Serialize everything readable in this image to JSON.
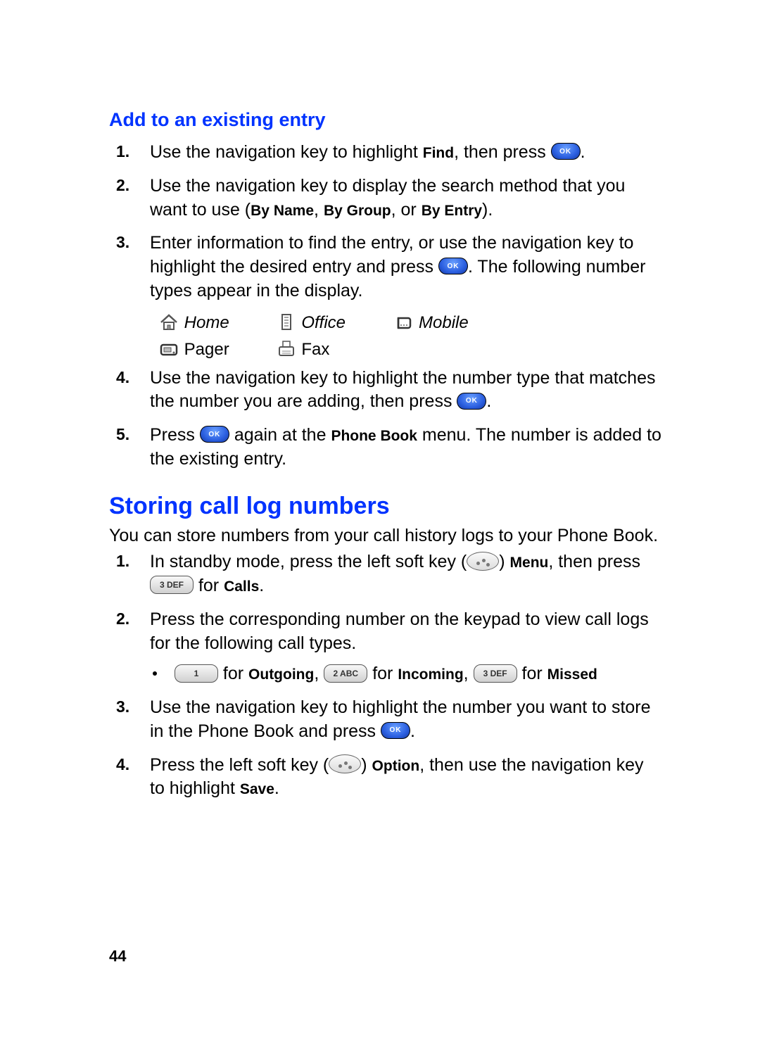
{
  "page_number": "44",
  "sectionA": {
    "title": "Add to an existing entry",
    "steps": [
      {
        "num": "1.",
        "t1": "Use the navigation key to highlight ",
        "b1": "Find",
        "t2": ", then press "
      },
      {
        "num": "2.",
        "t1": "Use the navigation key to display the search method that you want to use (",
        "b1": "By Name",
        "t2": ", ",
        "b2": "By Group",
        "t3": ", or ",
        "b3": "By Entry",
        "t4": ")."
      },
      {
        "num": "3.",
        "t1": "Enter information to find the entry, or use the navigation key to highlight the desired entry and press ",
        "t2": ". The following number types appear in the display."
      },
      {
        "num": "4.",
        "t1": "Use the navigation key to highlight the number type that matches the number you are adding, then press "
      },
      {
        "num": "5.",
        "t1": "Press ",
        "t2": " again at the ",
        "b1": "Phone Book",
        "t3": " menu. The number is added to the existing entry."
      }
    ],
    "types": {
      "home": "Home",
      "office": "Office",
      "mobile": "Mobile",
      "pager": "Pager",
      "fax": "Fax"
    }
  },
  "sectionB": {
    "title": "Storing call log numbers",
    "intro": "You can store numbers from your call history logs to your Phone Book.",
    "steps": [
      {
        "num": "1.",
        "t1": "In standby mode, press the left soft key (",
        "t2": ") ",
        "b1": "Menu",
        "t3": ", then press ",
        "t4": " for ",
        "b2": "Calls",
        "t5": "."
      },
      {
        "num": "2.",
        "t1": "Press the corresponding number on the keypad to view call logs for the following call types.",
        "bullet_for": " for ",
        "bullet_outgoing": "Outgoing",
        "bullet_sep1": ", ",
        "bullet_for2": " for ",
        "bullet_incoming": "Incoming",
        "bullet_sep2": ", ",
        "bullet_for3": " for ",
        "bullet_missed": "Missed"
      },
      {
        "num": "3.",
        "t1": "Use the navigation key to highlight the number you want to store in the Phone Book and press "
      },
      {
        "num": "4.",
        "t1": "Press the left soft key (",
        "t2": ") ",
        "b1": "Option",
        "t3": ", then use the navigation key to highlight ",
        "b2": "Save",
        "t4": "."
      }
    ]
  },
  "icons": {
    "ok": "OK",
    "key1": "1",
    "key2": "2 ABC",
    "key3": "3 DEF"
  }
}
